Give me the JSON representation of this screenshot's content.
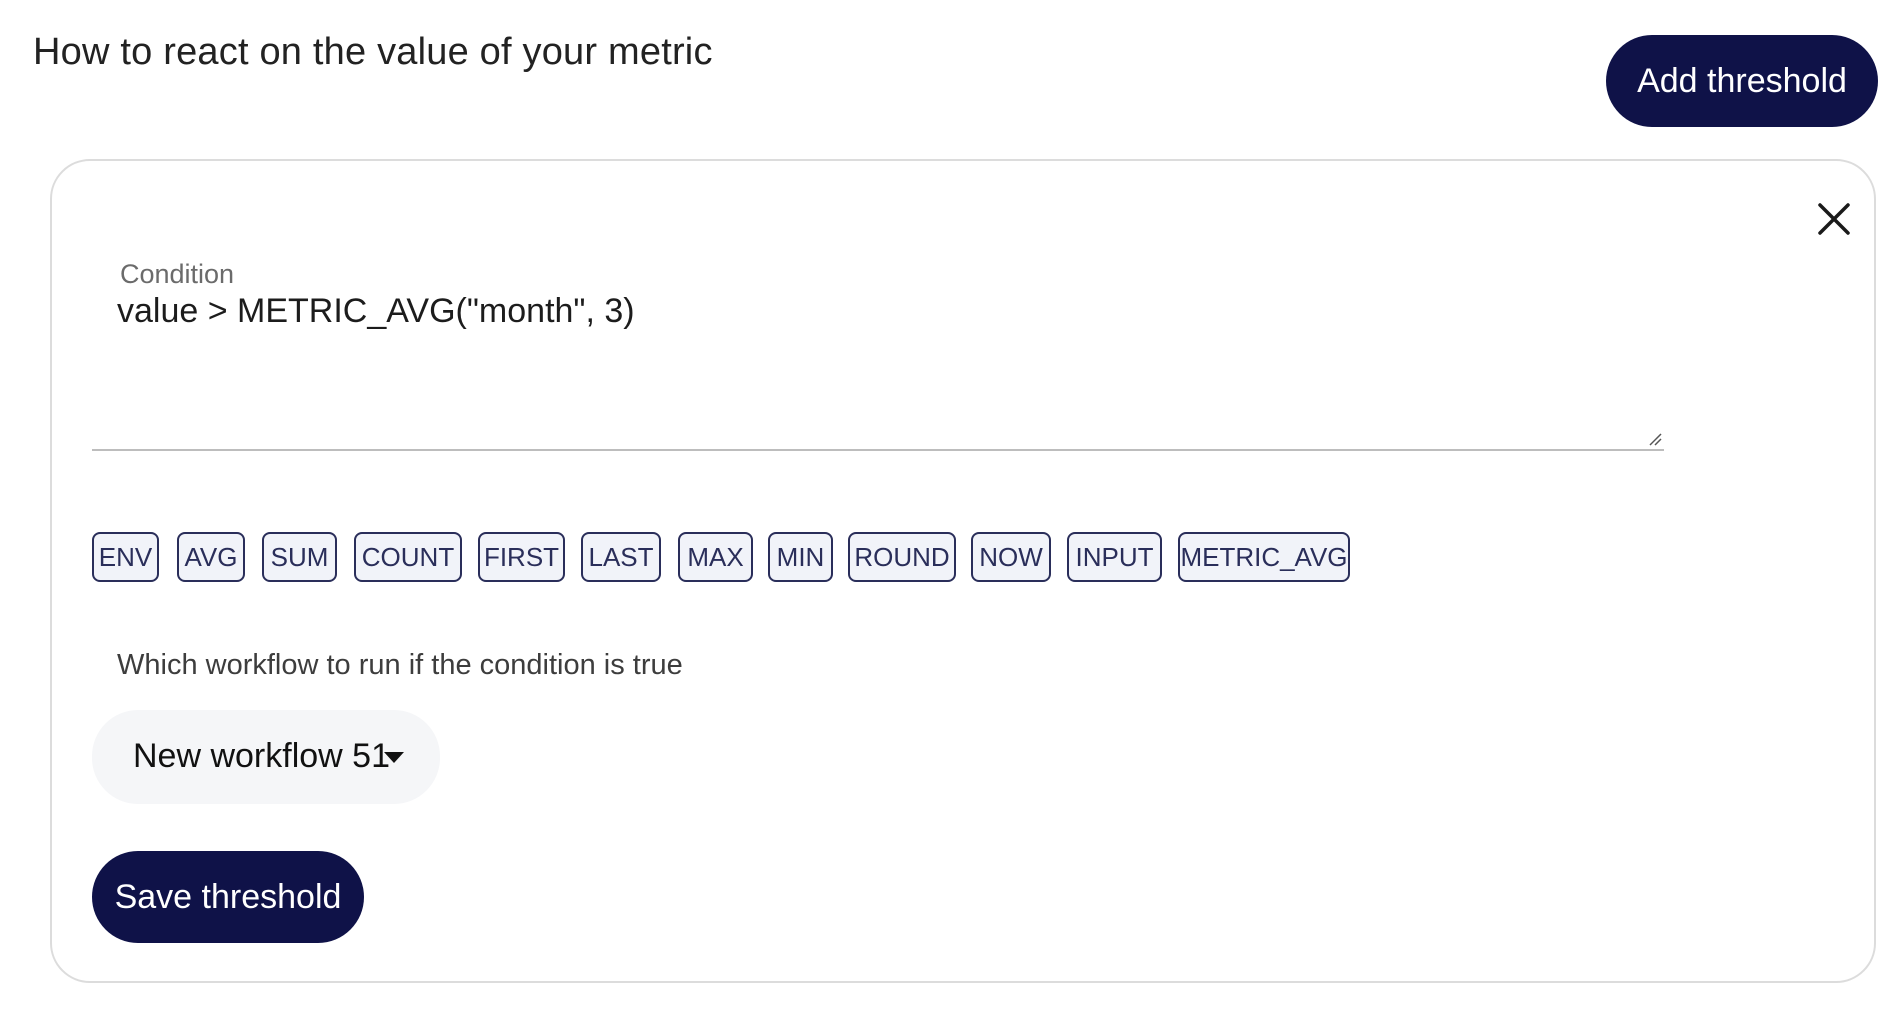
{
  "header": {
    "title": "How to react on the value of your metric",
    "add_button_label": "Add threshold"
  },
  "threshold_card": {
    "close_icon": "close-icon",
    "condition": {
      "label": "Condition",
      "value": "value > METRIC_AVG(\"month\", 3)"
    },
    "functions": [
      "ENV",
      "AVG",
      "SUM",
      "COUNT",
      "FIRST",
      "LAST",
      "MAX",
      "MIN",
      "ROUND",
      "NOW",
      "INPUT",
      "METRIC_AVG"
    ],
    "workflow": {
      "label": "Which workflow to run if the condition is true",
      "selected": "New workflow 51",
      "dropdown_icon": "caret-down-icon"
    },
    "save_button_label": "Save threshold"
  },
  "colors": {
    "primary": "#0f1248",
    "chip_border": "#2a2e5a",
    "chip_background": "#f1f3f9",
    "select_background": "#f5f6f8",
    "card_border": "#dcdcdc"
  }
}
